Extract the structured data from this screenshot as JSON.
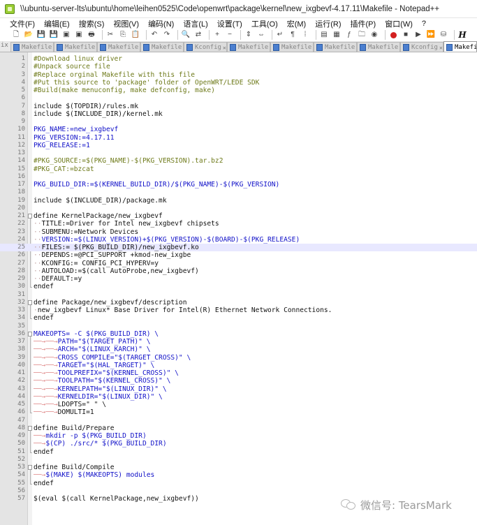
{
  "window": {
    "title": "\\\\ubuntu-server-lts\\ubuntu\\home\\leihen0525\\Code\\openwrt\\package\\kernel\\new_ixgbevf-4.17.11\\Makefile - Notepad++"
  },
  "menu": [
    "文件(F)",
    "编辑(E)",
    "搜索(S)",
    "视图(V)",
    "编码(N)",
    "语言(L)",
    "设置(T)",
    "工具(O)",
    "宏(M)",
    "运行(R)",
    "插件(P)",
    "窗口(W)",
    "?"
  ],
  "toolbar": [
    {
      "icon": "new-file-icon",
      "glyph": "🗋"
    },
    {
      "icon": "open-file-icon",
      "glyph": "📂"
    },
    {
      "icon": "save-icon",
      "glyph": "💾"
    },
    {
      "icon": "save-all-icon",
      "glyph": "💾"
    },
    {
      "icon": "close-icon",
      "glyph": "▣"
    },
    {
      "icon": "close-all-icon",
      "glyph": "▣"
    },
    {
      "icon": "print-icon",
      "glyph": "🖶"
    },
    {
      "icon": "cut-icon",
      "glyph": "✂"
    },
    {
      "icon": "copy-icon",
      "glyph": "⎘"
    },
    {
      "icon": "paste-icon",
      "glyph": "📋"
    },
    {
      "icon": "undo-icon",
      "glyph": "↶"
    },
    {
      "icon": "redo-icon",
      "glyph": "↷"
    },
    {
      "icon": "find-icon",
      "glyph": "🔍"
    },
    {
      "icon": "replace-icon",
      "glyph": "⇄"
    },
    {
      "icon": "zoom-in-icon",
      "glyph": "+"
    },
    {
      "icon": "zoom-out-icon",
      "glyph": "−"
    },
    {
      "icon": "sync-vertical-icon",
      "glyph": "⇕"
    },
    {
      "icon": "sync-horizontal-icon",
      "glyph": "⇔"
    },
    {
      "icon": "word-wrap-icon",
      "glyph": "↵"
    },
    {
      "icon": "show-all-chars-icon",
      "glyph": "¶"
    },
    {
      "icon": "indent-guide-icon",
      "glyph": "⁞"
    },
    {
      "icon": "user-lang-icon",
      "glyph": "▤"
    },
    {
      "icon": "doc-map-icon",
      "glyph": "▦"
    },
    {
      "icon": "function-list-icon",
      "glyph": "ƒ"
    },
    {
      "icon": "folder-workspace-icon",
      "glyph": "🗀"
    },
    {
      "icon": "monitoring-icon",
      "glyph": "◉"
    },
    {
      "icon": "record-macro-icon",
      "glyph": "●"
    },
    {
      "icon": "stop-macro-icon",
      "glyph": "■"
    },
    {
      "icon": "play-macro-icon",
      "glyph": "▶"
    },
    {
      "icon": "run-macro-multiple-icon",
      "glyph": "⏩"
    },
    {
      "icon": "save-macro-icon",
      "glyph": "⛁"
    },
    {
      "icon": "function-h-icon",
      "glyph": "H"
    }
  ],
  "tabs": {
    "lead": "ix",
    "items": [
      "Makefile",
      "Makefile",
      "Makefile",
      "Makefile",
      "Kconfig",
      "Makefile",
      "Makefile",
      "Makefile",
      "Makefile",
      "Kconfig",
      "Makefile"
    ],
    "close_glyph": "✕"
  },
  "editor": {
    "highlighted_line": 25,
    "lines": [
      {
        "n": "1",
        "kind": "comment",
        "text": "#Download linux driver"
      },
      {
        "n": "2",
        "kind": "comment",
        "text": "#Unpack source file"
      },
      {
        "n": "3",
        "kind": "comment",
        "text": "#Replace orginal Makefile with this file"
      },
      {
        "n": "4",
        "kind": "comment",
        "text": "#Put this source to 'package' folder of OpenWRT/LEDE SDK"
      },
      {
        "n": "5",
        "kind": "comment",
        "text": "#Build(make menuconfig, make defconfig, make)"
      },
      {
        "n": "6",
        "kind": "plain",
        "text": ""
      },
      {
        "n": "7",
        "kind": "plain",
        "text": "include $(TOPDIR)/rules.mk"
      },
      {
        "n": "8",
        "kind": "plain",
        "text": "include $(INCLUDE_DIR)/kernel.mk"
      },
      {
        "n": "9",
        "kind": "plain",
        "text": ""
      },
      {
        "n": "10",
        "kind": "var",
        "text": "PKG_NAME:=new_ixgbevf"
      },
      {
        "n": "11",
        "kind": "var",
        "text": "PKG_VERSION:=4.17.11"
      },
      {
        "n": "12",
        "kind": "var",
        "text": "PKG_RELEASE:=1"
      },
      {
        "n": "13",
        "kind": "plain",
        "text": ""
      },
      {
        "n": "14",
        "kind": "comment",
        "text": "#PKG_SOURCE:=$(PKG_NAME)-$(PKG_VERSION).tar.bz2"
      },
      {
        "n": "15",
        "kind": "comment",
        "text": "#PKG_CAT:=bzcat"
      },
      {
        "n": "16",
        "kind": "plain",
        "text": ""
      },
      {
        "n": "17",
        "kind": "var",
        "text": "PKG_BUILD_DIR:=$(KERNEL_BUILD_DIR)/$(PKG_NAME)-$(PKG_VERSION)"
      },
      {
        "n": "18",
        "kind": "plain",
        "text": ""
      },
      {
        "n": "19",
        "kind": "plain",
        "text": "include $(INCLUDE_DIR)/package.mk"
      },
      {
        "n": "20",
        "kind": "plain",
        "text": ""
      },
      {
        "n": "21",
        "kind": "plain",
        "text": "define KernelPackage/new_ixgbevf"
      },
      {
        "n": "22",
        "kind": "plain",
        "text": "  TITLE:=Driver for Intel new_ixgbevf chipsets"
      },
      {
        "n": "23",
        "kind": "plain",
        "text": "  SUBMENU:=Network Devices"
      },
      {
        "n": "24",
        "kind": "var",
        "text": "  VERSION:=$(LINUX_VERSION)+$(PKG_VERSION)-$(BOARD)-$(PKG_RELEASE)"
      },
      {
        "n": "25",
        "kind": "plain",
        "text": "  FILES:= $(PKG_BUILD_DIR)/new_ixgbevf.ko"
      },
      {
        "n": "26",
        "kind": "plain",
        "text": "  DEPENDS:=@PCI_SUPPORT +kmod-new_ixgbe"
      },
      {
        "n": "27",
        "kind": "plain",
        "text": "  KCONFIG:= CONFIG_PCI_HYPERV=y"
      },
      {
        "n": "28",
        "kind": "plain",
        "text": "  AUTOLOAD:=$(call AutoProbe,new_ixgbevf)"
      },
      {
        "n": "29",
        "kind": "plain",
        "text": "  DEFAULT:=y"
      },
      {
        "n": "30",
        "kind": "plain",
        "text": "endef"
      },
      {
        "n": "31",
        "kind": "plain",
        "text": ""
      },
      {
        "n": "32",
        "kind": "plain",
        "text": "define Package/new_ixgbevf/description"
      },
      {
        "n": "33",
        "kind": "plain",
        "text": " new_ixgbevf Linux* Base Driver for Intel(R) Ethernet Network Connections."
      },
      {
        "n": "34",
        "kind": "plain",
        "text": "endef"
      },
      {
        "n": "35",
        "kind": "plain",
        "text": ""
      },
      {
        "n": "36",
        "kind": "var",
        "text": "MAKEOPTS= -C $(PKG_BUILD_DIR) \\"
      },
      {
        "n": "37",
        "kind": "tab",
        "text": "PATH=\"$(TARGET_PATH)\" \\"
      },
      {
        "n": "38",
        "kind": "tab",
        "text": "ARCH=\"$(LINUX_KARCH)\" \\"
      },
      {
        "n": "39",
        "kind": "tab",
        "text": "CROSS_COMPILE=\"$(TARGET_CROSS)\" \\"
      },
      {
        "n": "40",
        "kind": "tab",
        "text": "TARGET=\"$(HAL_TARGET)\" \\"
      },
      {
        "n": "41",
        "kind": "tab",
        "text": "TOOLPREFIX=\"$(KERNEL_CROSS)\" \\"
      },
      {
        "n": "42",
        "kind": "tab",
        "text": "TOOLPATH=\"$(KERNEL_CROSS)\" \\"
      },
      {
        "n": "43",
        "kind": "tab",
        "text": "KERNELPATH=\"$(LINUX_DIR)\" \\"
      },
      {
        "n": "44",
        "kind": "tab",
        "text": "KERNELDIR=\"$(LINUX_DIR)\" \\"
      },
      {
        "n": "45",
        "kind": "tab",
        "text": "LDOPTS=\" \" \\"
      },
      {
        "n": "46",
        "kind": "tab",
        "text": "DOMULTI=1"
      },
      {
        "n": "47",
        "kind": "plain",
        "text": ""
      },
      {
        "n": "48",
        "kind": "plain",
        "text": "define Build/Prepare"
      },
      {
        "n": "49",
        "kind": "tab1",
        "text": "mkdir -p $(PKG_BUILD_DIR)"
      },
      {
        "n": "50",
        "kind": "tab1",
        "text": "$(CP) ./src/* $(PKG_BUILD_DIR)"
      },
      {
        "n": "51",
        "kind": "plain",
        "text": "endef"
      },
      {
        "n": "52",
        "kind": "plain",
        "text": ""
      },
      {
        "n": "53",
        "kind": "plain",
        "text": "define Build/Compile"
      },
      {
        "n": "54",
        "kind": "tab1",
        "text": "$(MAKE) $(MAKEOPTS) modules"
      },
      {
        "n": "55",
        "kind": "plain",
        "text": "endef"
      },
      {
        "n": "56",
        "kind": "plain",
        "text": ""
      },
      {
        "n": "57",
        "kind": "plain",
        "text": "$(eval $(call KernelPackage,new_ixgbevf))"
      }
    ]
  },
  "watermark": {
    "icon": "wechat-icon",
    "text": "微信号: TearsMark"
  },
  "colors": {
    "comment": "#6e7a1a",
    "variable": "#1010c8",
    "highlight_line": "#e8e8ff",
    "gutter": "#e4e4e4"
  }
}
